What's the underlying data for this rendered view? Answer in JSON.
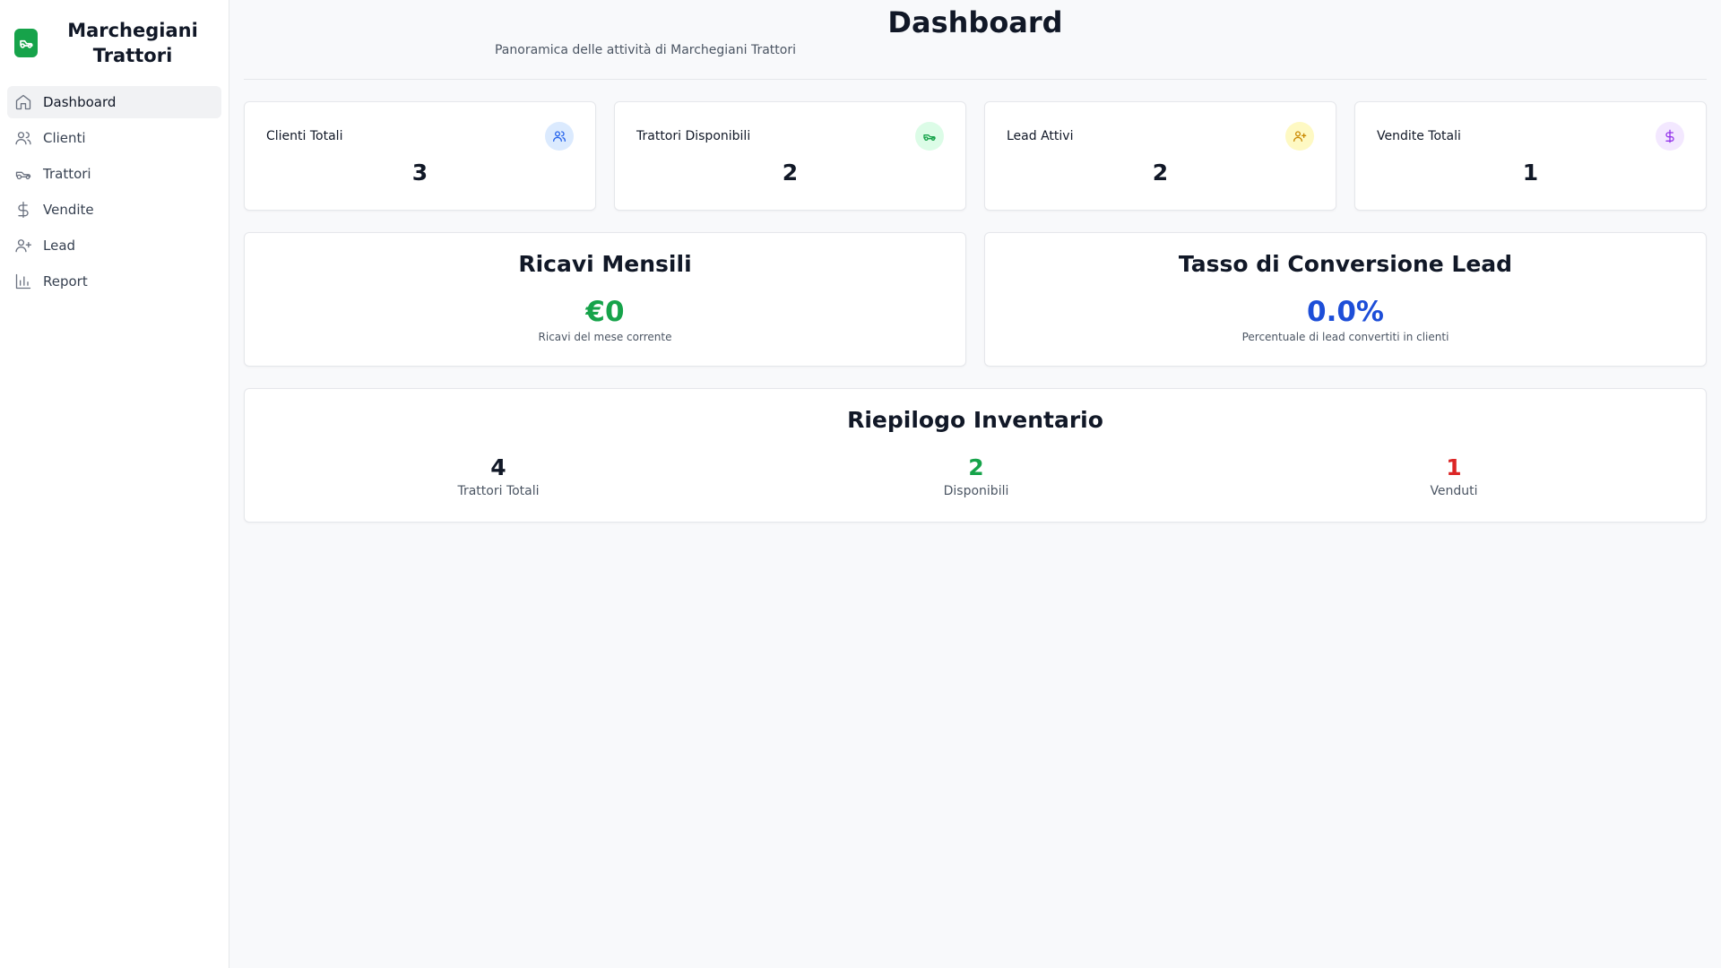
{
  "brand": {
    "name": "Marchegiani Trattori",
    "accent": "#16a34a"
  },
  "sidebar": {
    "items": [
      {
        "label": "Dashboard",
        "icon": "home-icon",
        "active": true
      },
      {
        "label": "Clienti",
        "icon": "users-icon",
        "active": false
      },
      {
        "label": "Trattori",
        "icon": "tractor-icon",
        "active": false
      },
      {
        "label": "Vendite",
        "icon": "dollar-icon",
        "active": false
      },
      {
        "label": "Lead",
        "icon": "user-plus-icon",
        "active": false
      },
      {
        "label": "Report",
        "icon": "bar-chart-icon",
        "active": false
      }
    ]
  },
  "header": {
    "title": "Dashboard",
    "subtitle": "Panoramica delle attività di Marchegiani Trattori"
  },
  "stats": [
    {
      "label": "Clienti Totali",
      "value": "3",
      "icon": "users-icon",
      "icon_bg": "#dbeafe",
      "icon_color": "#2563eb"
    },
    {
      "label": "Trattori Disponibili",
      "value": "2",
      "icon": "tractor-icon",
      "icon_bg": "#dcfce7",
      "icon_color": "#16a34a"
    },
    {
      "label": "Lead Attivi",
      "value": "2",
      "icon": "user-plus-icon",
      "icon_bg": "#fef9c3",
      "icon_color": "#ca8a04"
    },
    {
      "label": "Vendite Totali",
      "value": "1",
      "icon": "dollar-icon",
      "icon_bg": "#f3e8ff",
      "icon_color": "#9333ea"
    }
  ],
  "revenue": {
    "title": "Ricavi Mensili",
    "value": "€0",
    "caption": "Ricavi del mese corrente",
    "color": "#16a34a"
  },
  "conversion": {
    "title": "Tasso di Conversione Lead",
    "value": "0.0%",
    "caption": "Percentuale di lead convertiti in clienti",
    "color": "#1d4ed8"
  },
  "inventory": {
    "title": "Riepilogo Inventario",
    "items": [
      {
        "value": "4",
        "label": "Trattori Totali",
        "color": "#111827"
      },
      {
        "value": "2",
        "label": "Disponibili",
        "color": "#16a34a"
      },
      {
        "value": "1",
        "label": "Venduti",
        "color": "#dc2626"
      }
    ]
  }
}
